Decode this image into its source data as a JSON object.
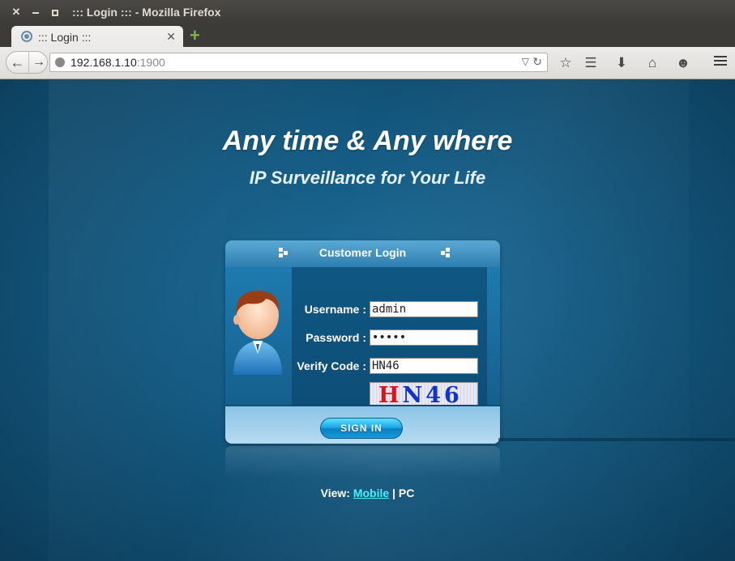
{
  "window": {
    "title": "::: Login ::: - Mozilla Firefox",
    "close_glyph": "✕",
    "min_glyph": "",
    "max_glyph": ""
  },
  "tab": {
    "label": "::: Login :::",
    "close_glyph": "✕",
    "new_tab_glyph": "+"
  },
  "nav": {
    "back_glyph": "←",
    "forward_glyph": "→",
    "url_host": "192.168.1.10",
    "url_port": ":1900",
    "dropdown_glyph": "▽",
    "reload_glyph": "↻",
    "icons": [
      "star-icon",
      "reading-list-icon",
      "download-icon",
      "home-icon",
      "smiley-icon",
      "menu-icon"
    ],
    "star_glyph": "☆",
    "reading_glyph": "☰",
    "download_glyph": "⬇",
    "home_glyph": "⌂",
    "smiley_glyph": "☻"
  },
  "page": {
    "headline": "Any time & Any where",
    "subheadline": "IP Surveillance for Your Life",
    "login_panel": {
      "title": "Customer Login",
      "username_label": "Username :",
      "username_value": "admin",
      "password_label": "Password :",
      "password_value": "•••••",
      "verify_label": "Verify Code :",
      "verify_value": "HN46",
      "captcha_chars": [
        "H",
        "N",
        "4",
        "6"
      ],
      "signin_label": "SIGN IN"
    },
    "view_label": "View:",
    "view_mobile": "Mobile",
    "view_separator": "|",
    "view_pc": "PC"
  },
  "colors": {
    "background": "#145a82",
    "link": "#3ff3ff",
    "captcha_red": "#e0111a",
    "captcha_blue": "#1133cc"
  }
}
